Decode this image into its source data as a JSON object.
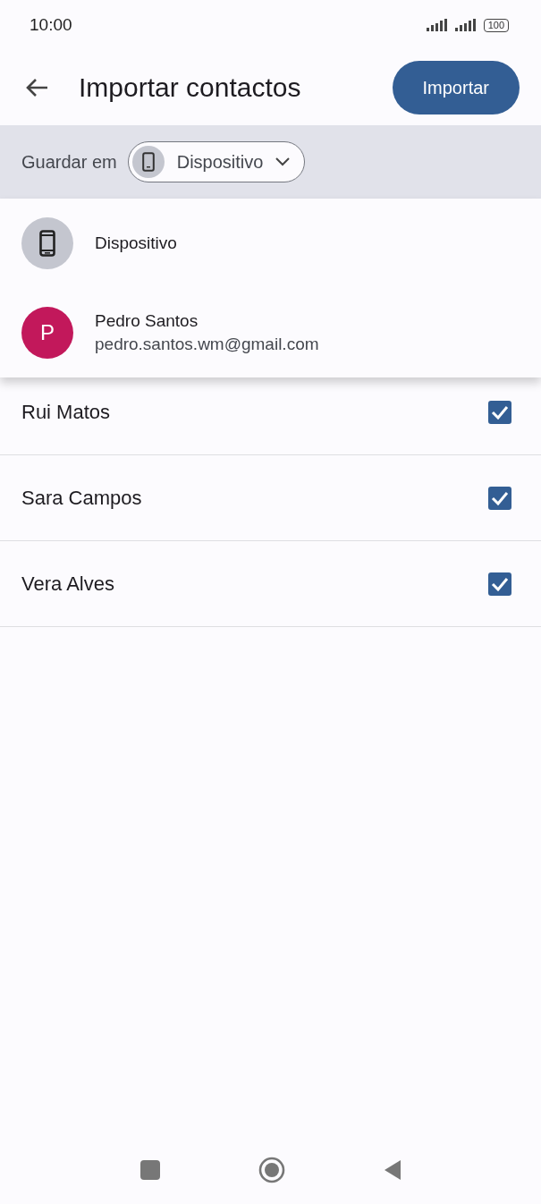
{
  "status_bar": {
    "time": "10:00",
    "battery": "100"
  },
  "app_bar": {
    "title": "Importar contactos",
    "action": "Importar"
  },
  "save_to": {
    "label": "Guardar em",
    "value": "Dispositivo",
    "expanded": true
  },
  "menu": [
    {
      "kind": "device",
      "title": "Dispositivo"
    },
    {
      "kind": "account",
      "initial": "P",
      "title": "Pedro Santos",
      "subtitle": "pedro.santos.wm@gmail.com",
      "color": "#c2185b"
    }
  ],
  "contacts": [
    {
      "name": "Rui Matos",
      "checked": true
    },
    {
      "name": "Sara Campos",
      "checked": true
    },
    {
      "name": "Vera Alves",
      "checked": true
    }
  ]
}
